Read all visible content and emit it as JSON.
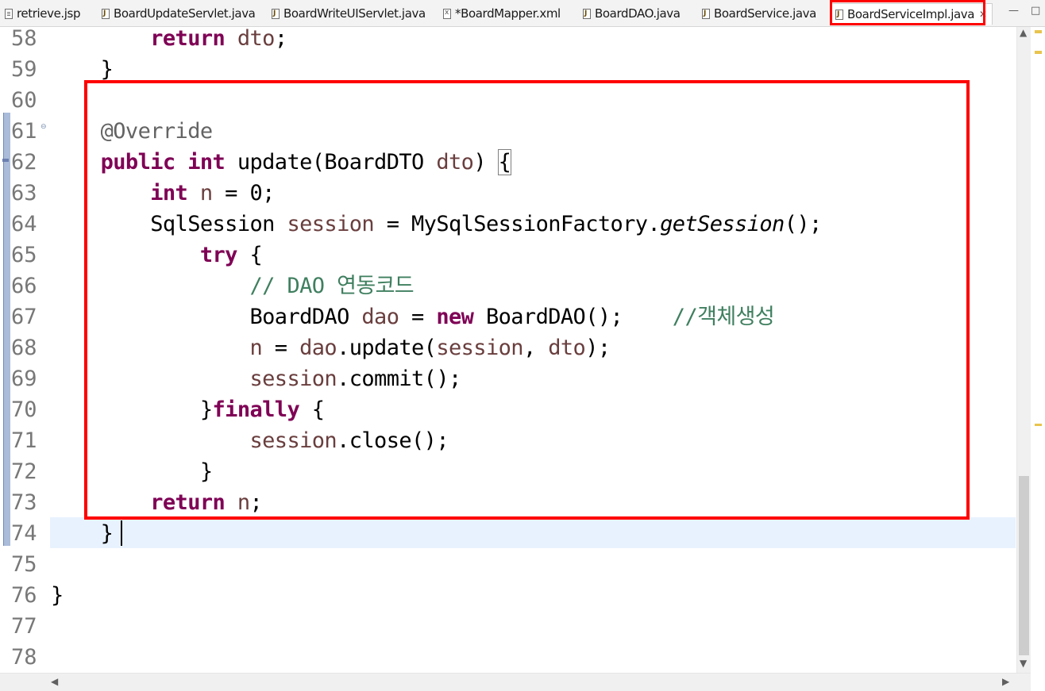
{
  "tabs": [
    {
      "label": "retrieve.jsp",
      "icon": "jsp-file-icon"
    },
    {
      "label": "BoardUpdateServlet.java",
      "icon": "java-file-icon"
    },
    {
      "label": "BoardWriteUIServlet.java",
      "icon": "java-file-icon"
    },
    {
      "label": "*BoardMapper.xml",
      "icon": "xml-file-icon"
    },
    {
      "label": "BoardDAO.java",
      "icon": "java-file-icon"
    },
    {
      "label": "BoardService.java",
      "icon": "java-file-icon"
    },
    {
      "label": "BoardServiceImpl.java",
      "icon": "java-file-icon",
      "active": true,
      "close": "✕"
    }
  ],
  "window": {
    "minimize": "—",
    "maximize": "□"
  },
  "lines": [
    {
      "n": "58",
      "code": "        return dto;"
    },
    {
      "n": "59",
      "code": "    }"
    },
    {
      "n": "60",
      "code": ""
    },
    {
      "n": "61",
      "code": "    @Override"
    },
    {
      "n": "62",
      "code": "    public int update(BoardDTO dto) {"
    },
    {
      "n": "63",
      "code": "        int n = 0;"
    },
    {
      "n": "64",
      "code": "        SqlSession session = MySqlSessionFactory.getSession();"
    },
    {
      "n": "65",
      "code": "            try {"
    },
    {
      "n": "66",
      "code": "                // DAO 연동코드"
    },
    {
      "n": "67",
      "code": "                BoardDAO dao = new BoardDAO();    //객체생성"
    },
    {
      "n": "68",
      "code": "                n = dao.update(session, dto);"
    },
    {
      "n": "69",
      "code": "                session.commit();"
    },
    {
      "n": "70",
      "code": "            }finally {"
    },
    {
      "n": "71",
      "code": "                session.close();"
    },
    {
      "n": "72",
      "code": "            }"
    },
    {
      "n": "73",
      "code": "        return n;"
    },
    {
      "n": "74",
      "code": "    }"
    },
    {
      "n": "75",
      "code": ""
    },
    {
      "n": "76",
      "code": "}"
    },
    {
      "n": "77",
      "code": ""
    },
    {
      "n": "78",
      "code": ""
    }
  ],
  "colors": {
    "keyword": "#7f0055",
    "comment": "#3f7f5f",
    "annotation": "#646464",
    "variable": "#6a3e3e",
    "highlight": "#ff0000",
    "current_line": "#e8f2fe"
  }
}
